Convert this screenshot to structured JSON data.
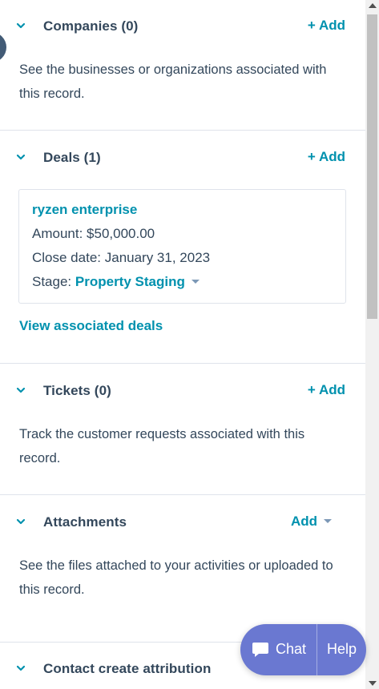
{
  "companies": {
    "title": "Companies (0)",
    "add_label": "+ Add",
    "description": "See the businesses or organizations associated with this record."
  },
  "deals": {
    "title": "Deals (1)",
    "add_label": "+ Add",
    "card": {
      "name": "ryzen enterprise",
      "amount_label": "Amount:",
      "amount_value": "$50,000.00",
      "close_label": "Close date:",
      "close_value": "January 31, 2023",
      "stage_label": "Stage:",
      "stage_value": "Property Staging"
    },
    "view_link": "View associated deals"
  },
  "tickets": {
    "title": "Tickets (0)",
    "add_label": "+ Add",
    "description": "Track the customer requests associated with this record."
  },
  "attachments": {
    "title": "Attachments",
    "add_label": "Add",
    "description": "See the files attached to your activities or uploaded to this record."
  },
  "attribution": {
    "title": "Contact create attribution"
  },
  "chat_widget": {
    "chat_label": "Chat",
    "help_label": "Help"
  },
  "colors": {
    "accent": "#0091ae",
    "text": "#33475b",
    "border": "#dfe3eb",
    "chat_bg": "#6a78d1"
  }
}
